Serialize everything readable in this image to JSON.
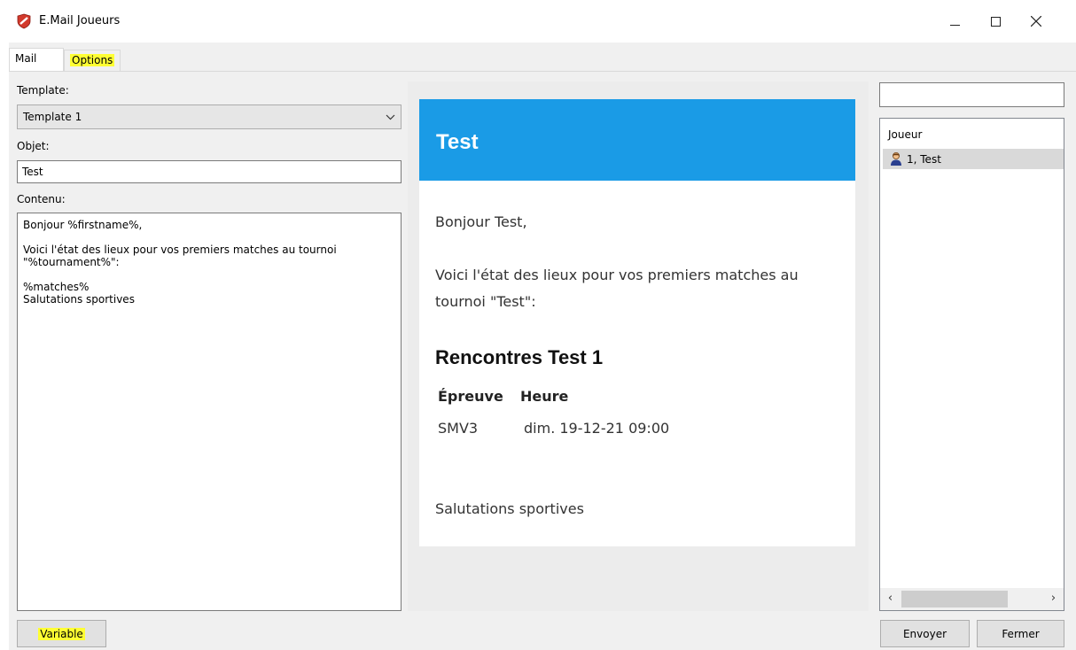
{
  "window": {
    "title": "E.Mail Joueurs"
  },
  "tabs": [
    {
      "label": "Mail",
      "active": true
    },
    {
      "label": "Options",
      "active": false
    }
  ],
  "form": {
    "template_label": "Template:",
    "template_value": "Template 1",
    "subject_label": "Objet:",
    "subject_value": "Test",
    "content_label": "Contenu:",
    "content_value": "Bonjour %firstname%,\n\nVoici l'état des lieux pour vos premiers matches au tournoi\n\"%tournament%\":\n\n%matches%\nSalutations sportives"
  },
  "preview": {
    "header": "Test",
    "greeting": "Bonjour Test,",
    "intro_line1": "Voici l'état des lieux pour vos premiers matches au",
    "intro_line2": "tournoi \"Test\":",
    "section_title": "Rencontres Test 1",
    "table_headers": [
      "Épreuve",
      "Heure"
    ],
    "table_rows": [
      [
        "SMV3",
        "dim. 19-12-21 09:00"
      ]
    ],
    "closing": "Salutations sportives",
    "header_color": "#1a9be6"
  },
  "players": {
    "search_value": "",
    "column_header": "Joueur",
    "rows": [
      {
        "label": "1, Test",
        "icon": "player-icon"
      }
    ]
  },
  "buttons": {
    "variable": "Variable",
    "send": "Envoyer",
    "close": "Fermer"
  },
  "colors": {
    "highlight": "#ffff33"
  }
}
